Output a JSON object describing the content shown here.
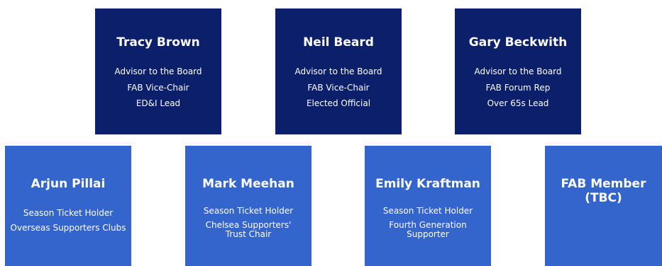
{
  "board": {
    "top": [
      {
        "name": "Tracy Brown",
        "lines": [
          "Advisor to the Board",
          "FAB Vice-Chair",
          "ED&I Lead"
        ]
      },
      {
        "name": "Neil Beard",
        "lines": [
          "Advisor to the Board",
          "FAB Vice-Chair",
          "Elected Official"
        ]
      },
      {
        "name": "Gary Beckwith",
        "lines": [
          "Advisor to the Board",
          "FAB Forum Rep",
          "Over 65s Lead"
        ]
      }
    ],
    "bottom": [
      {
        "name": "Arjun Pillai",
        "lines": [
          "Season Ticket Holder",
          "Overseas Supporters Clubs"
        ]
      },
      {
        "name": "Mark Meehan",
        "lines": [
          "Season Ticket Holder",
          "Chelsea Supporters' Trust Chair"
        ]
      },
      {
        "name": "Emily Kraftman",
        "lines": [
          "Season Ticket Holder",
          "Fourth Generation Supporter"
        ]
      },
      {
        "name_lines": [
          "FAB Member",
          "(TBC)"
        ]
      }
    ]
  },
  "colors": {
    "top_card": "#0b1f6b",
    "bottom_card": "#3365cc",
    "text": "#ffffff"
  }
}
